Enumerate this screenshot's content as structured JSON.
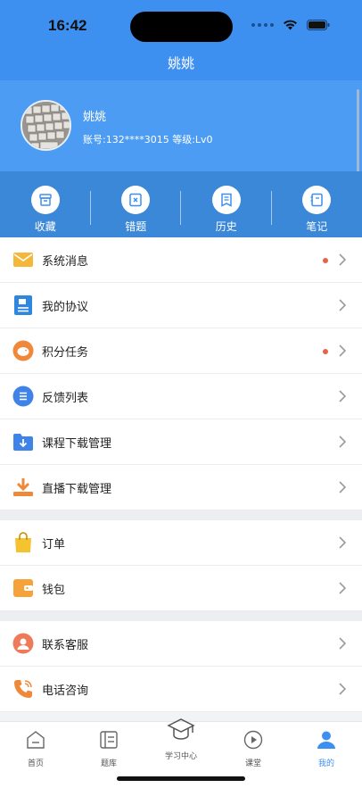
{
  "status": {
    "time": "16:42"
  },
  "nav": {
    "title": "姚姚"
  },
  "profile": {
    "name": "姚姚",
    "info": "账号:132****3015  等级:Lv0"
  },
  "quick": [
    {
      "label": "收藏",
      "icon": "favorites-box-icon"
    },
    {
      "label": "错题",
      "icon": "wrong-questions-icon"
    },
    {
      "label": "历史",
      "icon": "history-doc-icon"
    },
    {
      "label": "笔记",
      "icon": "notebook-icon"
    }
  ],
  "menu": {
    "group1": [
      {
        "label": "系统消息",
        "icon": "mail-icon",
        "dot": true
      },
      {
        "label": "我的协议",
        "icon": "agreement-icon",
        "dot": false
      },
      {
        "label": "积分任务",
        "icon": "piggy-bank-icon",
        "dot": true
      },
      {
        "label": "反馈列表",
        "icon": "feedback-list-icon",
        "dot": false
      },
      {
        "label": "课程下载管理",
        "icon": "course-download-icon",
        "dot": false
      },
      {
        "label": "直播下载管理",
        "icon": "live-download-icon",
        "dot": false
      }
    ],
    "group2": [
      {
        "label": "订单",
        "icon": "shopping-bag-icon"
      },
      {
        "label": "钱包",
        "icon": "wallet-icon"
      }
    ],
    "group3": [
      {
        "label": "联系客服",
        "icon": "customer-service-icon"
      },
      {
        "label": "电话咨询",
        "icon": "phone-icon"
      }
    ]
  },
  "tabs": [
    {
      "label": "首页",
      "icon": "home-icon"
    },
    {
      "label": "题库",
      "icon": "question-bank-icon"
    },
    {
      "label": "学习中心",
      "icon": "graduation-cap-icon"
    },
    {
      "label": "课堂",
      "icon": "play-circle-icon"
    },
    {
      "label": "我的",
      "icon": "user-icon",
      "active": true
    }
  ],
  "colors": {
    "primary": "#3d8ff0",
    "badge": "#e8624a"
  }
}
